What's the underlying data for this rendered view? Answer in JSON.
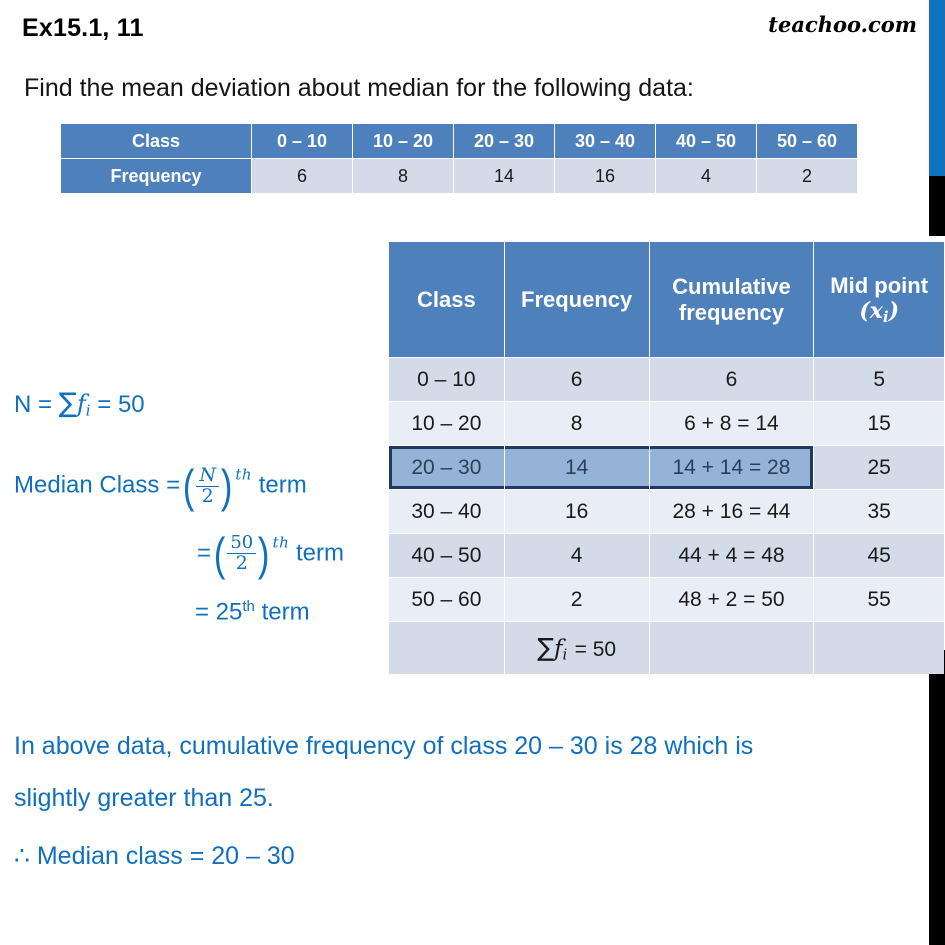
{
  "header": {
    "exercise_title": "Ex15.1,  11",
    "brand": "teachoo.com",
    "question": "Find the mean deviation about median for the following data:"
  },
  "top_table": {
    "row_labels": [
      "Class",
      "Frequency"
    ],
    "classes": [
      "0 – 10",
      "10 – 20",
      "20 – 30",
      "30 – 40",
      "40 – 50",
      "50 – 60"
    ],
    "frequencies": [
      "6",
      "8",
      "14",
      "16",
      "4",
      "2"
    ]
  },
  "work": {
    "n_label": "N =",
    "n_sum": "∑",
    "n_fi": "f",
    "n_fi_sub": "i",
    "n_eq": "=",
    "n_value": "50",
    "median_label": "Median Class =",
    "median_num": "N",
    "median_den": "2",
    "median_sup": "th",
    "median_term": "term",
    "line2_eq": "=",
    "line2_num": "50",
    "line2_den": "2",
    "line2_sup": "th",
    "line2_term": "term",
    "line3_eq": "= 25",
    "line3_sup": "th",
    "line3_term": "term"
  },
  "main_table": {
    "headers": {
      "class": "Class",
      "frequency": "Frequency",
      "cumulative_l1": "Cumulative",
      "cumulative_l2": "frequency",
      "midpoint_l1": "Mid point",
      "midpoint_l2_open": "(",
      "midpoint_l2_x": "x",
      "midpoint_l2_sub": "i",
      "midpoint_l2_close": ")"
    },
    "rows": [
      {
        "class": "0 – 10",
        "frequency": "6",
        "cumulative": "6",
        "midpoint": "5",
        "highlighted": false
      },
      {
        "class": "10 – 20",
        "frequency": "8",
        "cumulative": "6 + 8 = 14",
        "midpoint": "15",
        "highlighted": false
      },
      {
        "class": "20 – 30",
        "frequency": "14",
        "cumulative": "14 + 14 = 28",
        "midpoint": "25",
        "highlighted": true
      },
      {
        "class": "30 – 40",
        "frequency": "16",
        "cumulative": "28 + 16 = 44",
        "midpoint": "35",
        "highlighted": false
      },
      {
        "class": "40 – 50",
        "frequency": "4",
        "cumulative": "44 + 4 = 48",
        "midpoint": "45",
        "highlighted": false
      },
      {
        "class": "50 – 60",
        "frequency": "2",
        "cumulative": "48 + 2 = 50",
        "midpoint": "55",
        "highlighted": false
      }
    ],
    "total_row": {
      "sum_symbol": "∑",
      "sum_var": "f",
      "sum_sub": "i",
      "sum_value": "= 50"
    }
  },
  "conclusion": {
    "line1": "In above data, cumulative frequency of class 20 – 30 is 28 which is",
    "line2": "slightly greater than 25.",
    "line3": "∴  Median class = 20 – 30"
  },
  "colors": {
    "header_blue": "#4E81BC",
    "band_dark": "#D3DAE8",
    "band_light": "#E9EDF5",
    "highlight_fill": "#95B3D7",
    "highlight_border": "#1F3864",
    "text_blue": "#1070BD",
    "edge_blue": "#1073BE",
    "edge_black": "#000000"
  }
}
